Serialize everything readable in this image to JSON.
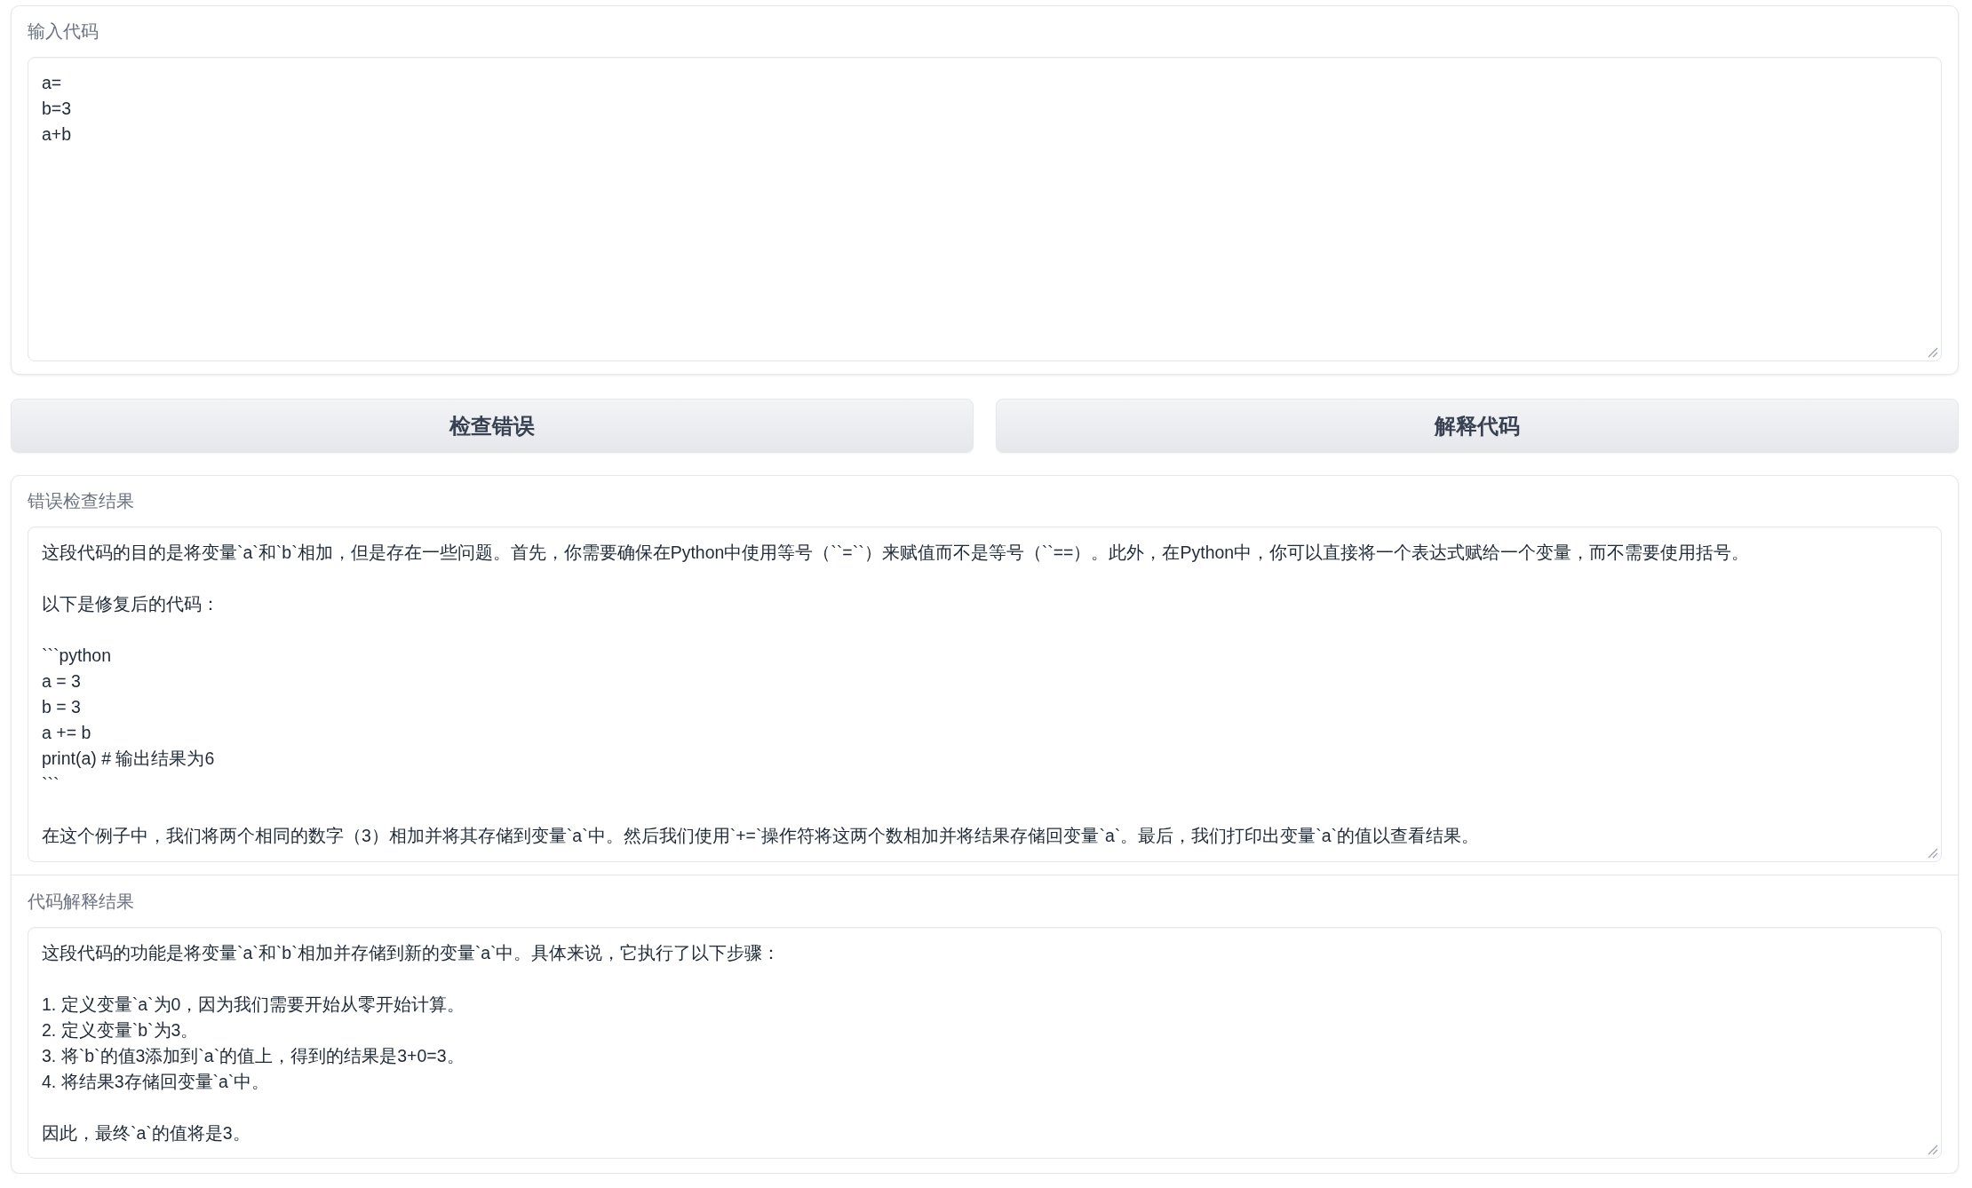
{
  "input_panel": {
    "label": "输入代码",
    "lines": [
      "a=",
      "b=3",
      "a+b"
    ]
  },
  "buttons": [
    "检查错误",
    "解释代码"
  ],
  "error_check": {
    "label": "错误检查结果",
    "paragraphs": [
      [
        "这段代码的目的是将变量`a`和`b`相加，但是存在一些问题。首先，你需要确保在Python中使用等号（``=``）来赋值而不是等号（``==）。此外，在Python中，你可以直接将一个表达式赋给一个变量，而不需要使用括号。"
      ],
      [
        "以下是修复后的代码："
      ],
      [
        "```python",
        "a = 3",
        "b = 3",
        "a += b",
        "print(a) # 输出结果为6",
        "```"
      ],
      [
        "在这个例子中，我们将两个相同的数字（3）相加并将其存储到变量`a`中。然后我们使用`+=`操作符将这两个数相加并将结果存储回变量`a`。最后，我们打印出变量`a`的值以查看结果。"
      ]
    ]
  },
  "explanation": {
    "label": "代码解释结果",
    "paragraphs": [
      [
        "这段代码的功能是将变量`a`和`b`相加并存储到新的变量`a`中。具体来说，它执行了以下步骤："
      ],
      [
        "1. 定义变量`a`为0，因为我们需要开始从零开始计算。",
        "2. 定义变量`b`为3。",
        "3. 将`b`的值3添加到`a`的值上，得到的结果是3+0=3。",
        "4. 将结果3存储回变量`a`中。"
      ],
      [
        "因此，最终`a`的值将是3。"
      ]
    ]
  }
}
